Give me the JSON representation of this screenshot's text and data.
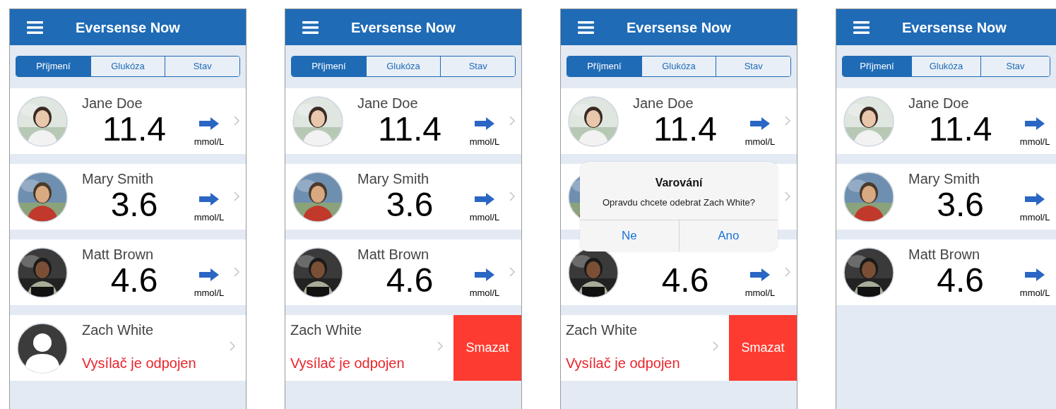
{
  "screens": [
    {
      "app_bar": {
        "title": "Eversense Now"
      },
      "segments": [
        {
          "label": "Příjmení",
          "selected": true
        },
        {
          "label": "Glukóza",
          "selected": false
        },
        {
          "label": "Stav",
          "selected": false
        }
      ],
      "patients": [
        {
          "kind": "reading",
          "name": "Jane Doe",
          "value": "11.4",
          "unit": "mmol/L",
          "trend_arrow": true,
          "chevron": true
        },
        {
          "kind": "reading",
          "name": "Mary Smith",
          "value": "3.6",
          "unit": "mmol/L",
          "trend_arrow": true,
          "chevron": true
        },
        {
          "kind": "reading",
          "name": "Matt Brown",
          "value": "4.6",
          "unit": "mmol/L",
          "trend_arrow": true,
          "chevron": true
        },
        {
          "kind": "disconnected",
          "name": "Zach White",
          "status": "Vysílač je odpojen",
          "chevron": true
        }
      ]
    },
    {
      "app_bar": {
        "title": "Eversense Now"
      },
      "segments": [
        {
          "label": "Příjmení",
          "selected": true
        },
        {
          "label": "Glukóza",
          "selected": false
        },
        {
          "label": "Stav",
          "selected": false
        }
      ],
      "patients": [
        {
          "kind": "reading",
          "name": "Jane Doe",
          "value": "11.4",
          "unit": "mmol/L",
          "trend_arrow": true,
          "chevron": true
        },
        {
          "kind": "reading",
          "name": "Mary Smith",
          "value": "3.6",
          "unit": "mmol/L",
          "trend_arrow": true,
          "chevron": true
        },
        {
          "kind": "reading",
          "name": "Matt Brown",
          "value": "4.6",
          "unit": "mmol/L",
          "trend_arrow": true,
          "chevron": true
        },
        {
          "kind": "disconnected",
          "name": "Zach White",
          "status": "Vysílač je odpojen",
          "chevron": true,
          "action": {
            "label": "Smazat"
          }
        }
      ]
    },
    {
      "app_bar": {
        "title": "Eversense Now"
      },
      "segments": [
        {
          "label": "Příjmení",
          "selected": true
        },
        {
          "label": "Glukóza",
          "selected": false
        },
        {
          "label": "Stav",
          "selected": false
        }
      ],
      "patients": [
        {
          "kind": "reading",
          "name": "Jane Doe",
          "value": "11.4",
          "unit": "mmol/L",
          "trend_arrow": true,
          "chevron": true
        },
        {
          "kind": "reading",
          "chevron": true
        },
        {
          "kind": "reading",
          "value": "4.6",
          "unit": "mmol/L",
          "trend_arrow": true,
          "chevron": true
        },
        {
          "kind": "disconnected",
          "name": "Zach White",
          "status": "Vysílač je odpojen",
          "chevron": true,
          "action": {
            "label": "Smazat"
          }
        }
      ],
      "dialog": {
        "title": "Varování",
        "message": "Opravdu chcete odebrat Zach White?",
        "buttons": [
          "Ne",
          "Ano"
        ]
      }
    },
    {
      "app_bar": {
        "title": "Eversense Now"
      },
      "segments": [
        {
          "label": "Příjmení",
          "selected": true
        },
        {
          "label": "Glukóza",
          "selected": false
        },
        {
          "label": "Stav",
          "selected": false
        }
      ],
      "patients": [
        {
          "kind": "reading",
          "name": "Jane Doe",
          "value": "11.4",
          "unit": "mmol/L",
          "trend_arrow": true,
          "chevron": false
        },
        {
          "kind": "reading",
          "name": "Mary Smith",
          "value": "3.6",
          "unit": "mmol/L",
          "trend_arrow": true,
          "chevron": false
        },
        {
          "kind": "reading",
          "name": "Matt Brown",
          "value": "4.6",
          "unit": "mmol/L",
          "trend_arrow": true,
          "chevron": false
        }
      ]
    }
  ]
}
